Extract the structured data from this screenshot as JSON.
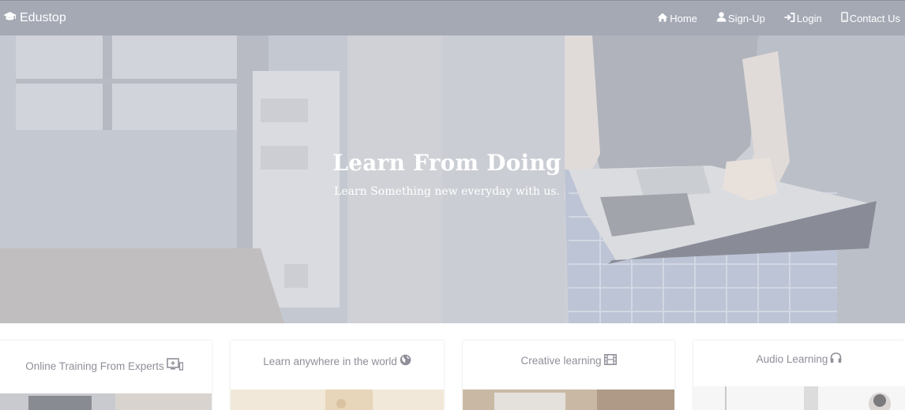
{
  "navbar": {
    "brand": "Edustop",
    "links": [
      {
        "label": "Home",
        "icon": "home-icon"
      },
      {
        "label": "Sign-Up",
        "icon": "user-icon"
      },
      {
        "label": "Login",
        "icon": "login-icon"
      },
      {
        "label": "Contact Us",
        "icon": "phone-icon"
      }
    ]
  },
  "hero": {
    "title": "Learn From Doing",
    "subtitle": "Learn Something new everyday with us."
  },
  "features": [
    {
      "title": "Online Training From Experts",
      "icon": "screen-icon"
    },
    {
      "title": "Learn anywhere in the world",
      "icon": "globe-icon"
    },
    {
      "title": "Creative learning",
      "icon": "film-icon"
    },
    {
      "title": "Audio Learning",
      "icon": "headphones-icon"
    }
  ],
  "colors": {
    "navbar": "#a4a9b4",
    "hero_overlay": "#c3c6cf",
    "card_text": "#8f8f99"
  }
}
